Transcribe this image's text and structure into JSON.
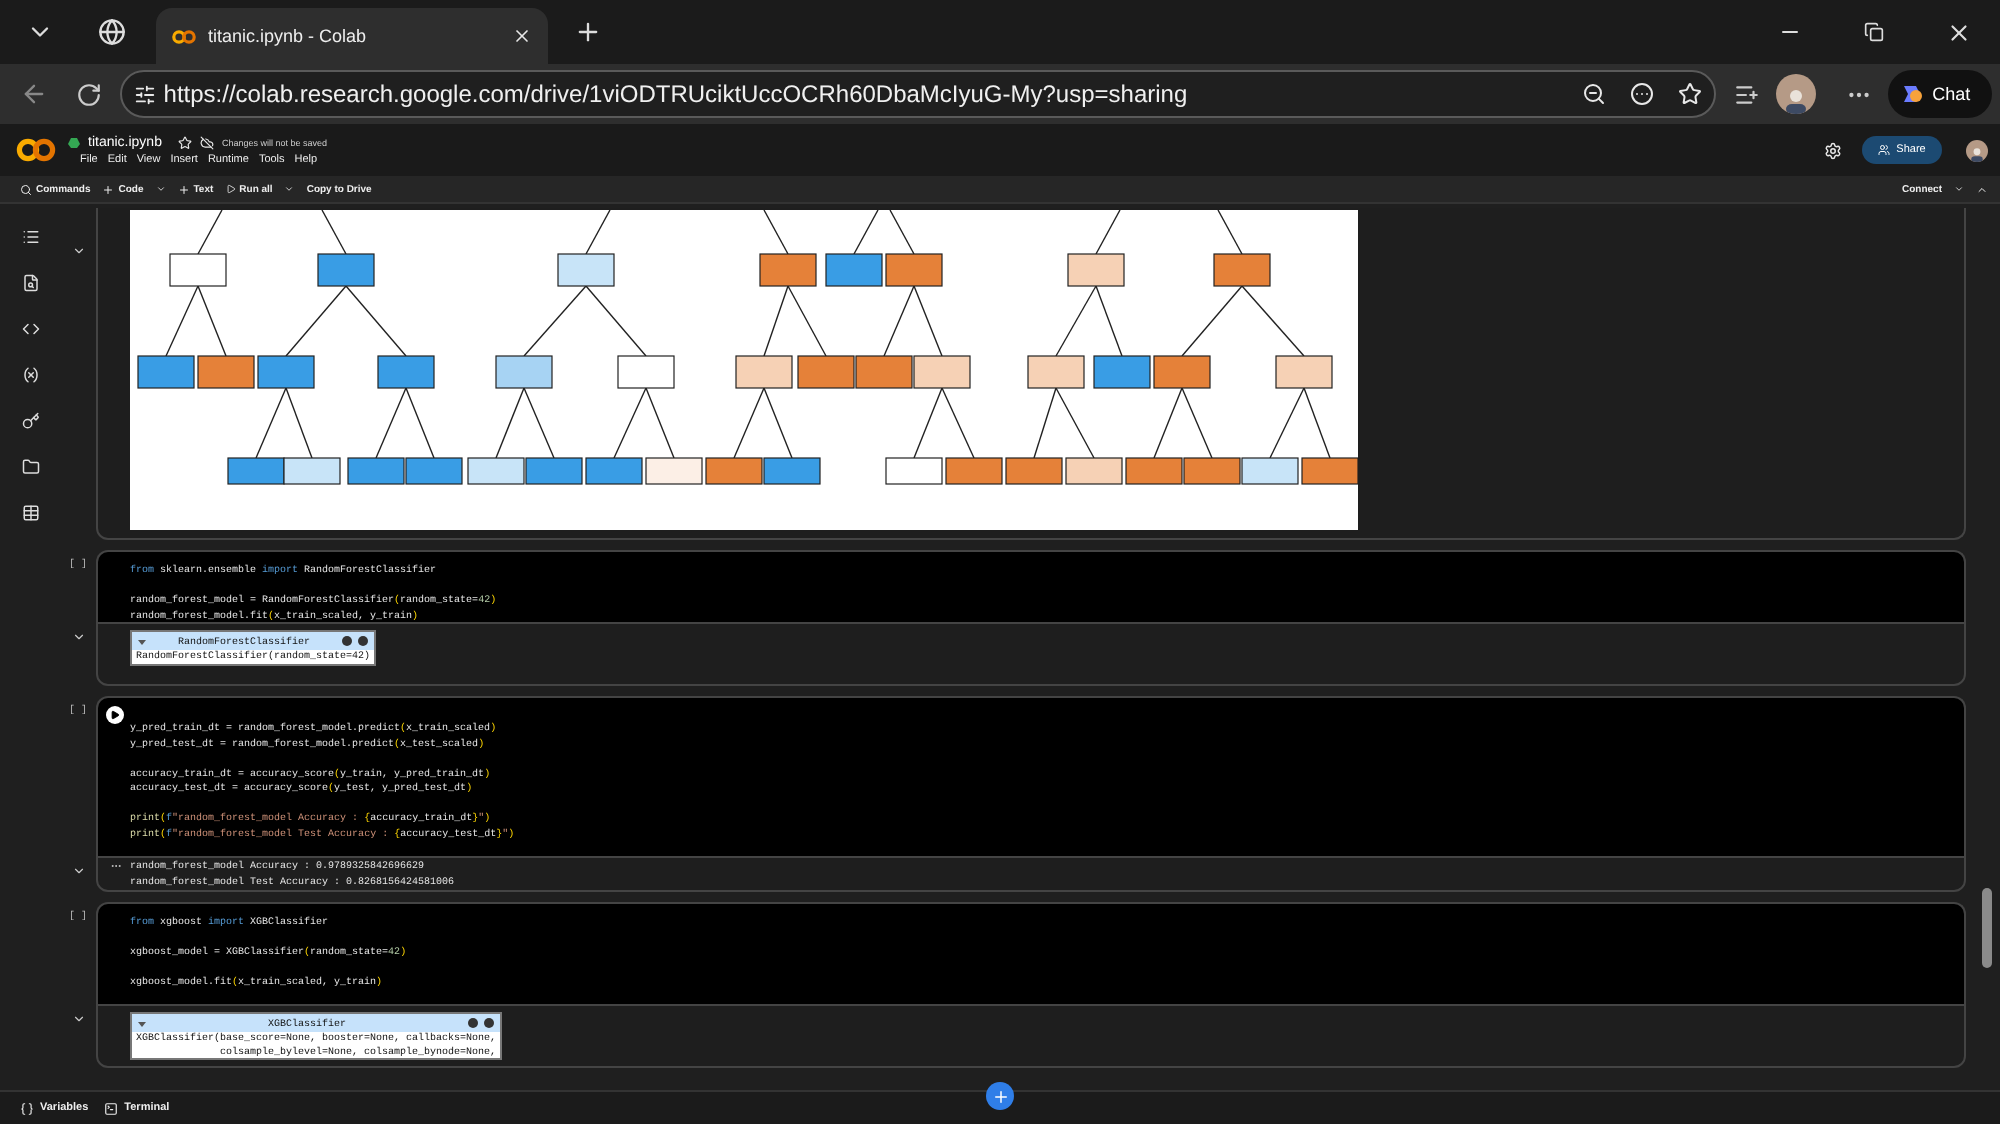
{
  "browser": {
    "tab_title": "titanic.ipynb - Colab",
    "url": "https://colab.research.google.com/drive/1viODTRUciktUccOCRh60DbaMcIyuG-My?usp=sharing",
    "chat_label": "Chat"
  },
  "notebook": {
    "title": "titanic.ipynb",
    "starred": false,
    "save_notice": "Changes will not be saved",
    "share_label": "Share",
    "menu": [
      "File",
      "Edit",
      "View",
      "Insert",
      "Runtime",
      "Tools",
      "Help"
    ]
  },
  "toolbar": {
    "left": [
      {
        "kind": "search",
        "label": "Commands"
      },
      {
        "kind": "add",
        "label": "Code"
      },
      {
        "kind": "caret"
      },
      {
        "kind": "add",
        "label": "Text"
      },
      {
        "kind": "play",
        "label": "Run all"
      },
      {
        "kind": "caret"
      },
      {
        "kind": "plain",
        "label": "Copy to Drive"
      }
    ],
    "connect_label": "Connect"
  },
  "cells": [
    {
      "kind": "output_only",
      "output": {
        "kind": "tree"
      }
    },
    {
      "kind": "code",
      "exec_count": "[ ]",
      "hovered": false,
      "lines": [
        {
          "blank_before": false,
          "tokens": [
            {
              "kind": "kw",
              "text": "from"
            },
            {
              "kind": "id",
              "text": " sklearn.ensemble "
            },
            {
              "kind": "kw",
              "text": "import"
            },
            {
              "kind": "id",
              "text": " RandomForestClassifier"
            }
          ]
        },
        {
          "blank_before": true,
          "tokens": [
            {
              "kind": "id",
              "text": "random_forest_model = RandomForestClassifier"
            },
            {
              "kind": "br",
              "text": "("
            },
            {
              "kind": "id",
              "text": "random_state="
            },
            {
              "kind": "num",
              "text": "42"
            },
            {
              "kind": "br",
              "text": ")"
            }
          ]
        },
        {
          "blank_before": false,
          "tokens": [
            {
              "kind": "id",
              "text": "random_forest_model.fit"
            },
            {
              "kind": "br",
              "text": "("
            },
            {
              "kind": "id",
              "text": "x_train_scaled, y_train"
            },
            {
              "kind": "br",
              "text": ")"
            }
          ]
        }
      ],
      "output": {
        "kind": "estimator",
        "header": "RandomForestClassifier",
        "lines": [
          "RandomForestClassifier(random_state=42)"
        ]
      }
    },
    {
      "kind": "code",
      "exec_count": "[ ]",
      "hovered": true,
      "lines": [
        {
          "blank_before": false,
          "tokens": [
            {
              "kind": "id",
              "text": "y_pred_train_dt = random_forest_model.predict"
            },
            {
              "kind": "br",
              "text": "("
            },
            {
              "kind": "id",
              "text": "x_train_scaled"
            },
            {
              "kind": "br",
              "text": ")"
            }
          ]
        },
        {
          "blank_before": false,
          "tokens": [
            {
              "kind": "id",
              "text": "y_pred_test_dt = random_forest_model.predict"
            },
            {
              "kind": "br",
              "text": "("
            },
            {
              "kind": "id",
              "text": "x_test_scaled"
            },
            {
              "kind": "br",
              "text": ")"
            }
          ]
        },
        {
          "blank_before": true,
          "tokens": [
            {
              "kind": "id",
              "text": "accuracy_train_dt = accuracy_score"
            },
            {
              "kind": "br",
              "text": "("
            },
            {
              "kind": "id",
              "text": "y_train, y_pred_train_dt"
            },
            {
              "kind": "br",
              "text": ")"
            }
          ]
        },
        {
          "blank_before": false,
          "tokens": [
            {
              "kind": "id",
              "text": "accuracy_test_dt = accuracy_score"
            },
            {
              "kind": "br",
              "text": "("
            },
            {
              "kind": "id",
              "text": "y_test, y_pred_test_dt"
            },
            {
              "kind": "br",
              "text": ")"
            }
          ]
        },
        {
          "blank_before": true,
          "tokens": [
            {
              "kind": "fn",
              "text": "print"
            },
            {
              "kind": "br",
              "text": "("
            },
            {
              "kind": "kw",
              "text": "f"
            },
            {
              "kind": "str",
              "text": "\"random_forest_model Accuracy : "
            },
            {
              "kind": "br",
              "text": "{"
            },
            {
              "kind": "id",
              "text": "accuracy_train_dt"
            },
            {
              "kind": "br",
              "text": "}"
            },
            {
              "kind": "str",
              "text": "\""
            },
            {
              "kind": "br",
              "text": ")"
            }
          ]
        },
        {
          "blank_before": false,
          "tokens": [
            {
              "kind": "fn",
              "text": "print"
            },
            {
              "kind": "br",
              "text": "("
            },
            {
              "kind": "kw",
              "text": "f"
            },
            {
              "kind": "str",
              "text": "\"random_forest_model Test Accuracy : "
            },
            {
              "kind": "br",
              "text": "{"
            },
            {
              "kind": "id",
              "text": "accuracy_test_dt"
            },
            {
              "kind": "br",
              "text": "}"
            },
            {
              "kind": "str",
              "text": "\""
            },
            {
              "kind": "br",
              "text": ")"
            }
          ]
        }
      ],
      "output": {
        "kind": "text",
        "lines": [
          "random_forest_model Accuracy : 0.9789325842696629",
          "random_forest_model Test Accuracy : 0.8268156424581006"
        ]
      }
    },
    {
      "kind": "code",
      "exec_count": "[ ]",
      "hovered": false,
      "lines": [
        {
          "blank_before": false,
          "tokens": [
            {
              "kind": "kw",
              "text": "from"
            },
            {
              "kind": "id",
              "text": " xgboost "
            },
            {
              "kind": "kw",
              "text": "import"
            },
            {
              "kind": "id",
              "text": " XGBClassifier"
            }
          ]
        },
        {
          "blank_before": true,
          "tokens": [
            {
              "kind": "id",
              "text": "xgboost_model = XGBClassifier"
            },
            {
              "kind": "br",
              "text": "("
            },
            {
              "kind": "id",
              "text": "random_state="
            },
            {
              "kind": "num",
              "text": "42"
            },
            {
              "kind": "br",
              "text": ")"
            }
          ]
        },
        {
          "blank_before": true,
          "tokens": [
            {
              "kind": "id",
              "text": "xgboost_model.fit"
            },
            {
              "kind": "br",
              "text": "("
            },
            {
              "kind": "id",
              "text": "x_train_scaled, y_train"
            },
            {
              "kind": "br",
              "text": ")"
            }
          ]
        }
      ],
      "output": {
        "kind": "estimator",
        "header": "XGBClassifier",
        "lines": [
          "XGBClassifier(base_score=None, booster=None, callbacks=None,",
          "              colsample_bylevel=None, colsample_bynode=None,"
        ]
      }
    }
  ],
  "bottom_bar": {
    "items": [
      {
        "kind": "variables",
        "label": "Variables"
      },
      {
        "kind": "terminal",
        "label": "Terminal"
      }
    ]
  }
}
